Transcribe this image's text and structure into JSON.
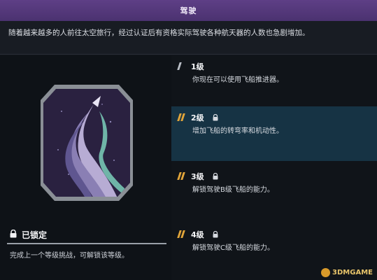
{
  "header": {
    "title": "驾驶"
  },
  "description": "随着越来越多的人前往太空旅行，经过认证后有资格实际驾驶各种航天器的人数也急剧增加。",
  "badge": {
    "icon": "rocket-badge-icon",
    "frame_color": "#8a8f96",
    "bg_color": "#2a2140"
  },
  "status": {
    "icon": "lock-icon",
    "label": "已锁定",
    "hint": "完成上一个等级挑战，可解锁该等级。"
  },
  "levels": [
    {
      "title": "1级",
      "desc": "你现在可以使用飞船推进器。",
      "locked": false,
      "active": false,
      "bars": 1,
      "bar_color": "#b9bec6"
    },
    {
      "title": "2级",
      "desc": "增加飞船的转弯率和机动性。",
      "locked": true,
      "active": true,
      "bars": 2,
      "bar_color": "#e1a53a"
    },
    {
      "title": "3级",
      "desc": "解锁驾驶B级飞船的能力。",
      "locked": true,
      "active": false,
      "bars": 2,
      "bar_color": "#e1a53a"
    },
    {
      "title": "4级",
      "desc": "解锁驾驶C级飞船的能力。",
      "locked": true,
      "active": false,
      "bars": 2,
      "bar_color": "#e1a53a"
    }
  ],
  "watermark": "3DMGAME"
}
